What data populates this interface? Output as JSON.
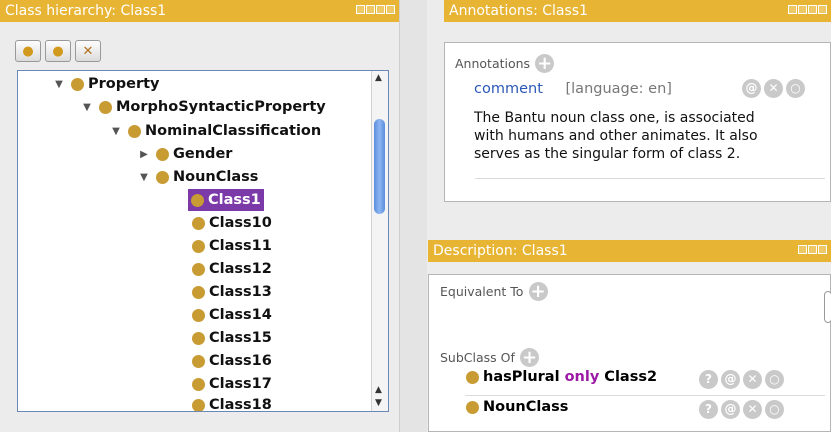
{
  "hierarchy": {
    "title": "Class hierarchy: Class1",
    "tree": [
      {
        "label": "Property",
        "toggle": "▼"
      },
      {
        "label": "MorphoSyntacticProperty",
        "toggle": "▼"
      },
      {
        "label": "NominalClassification",
        "toggle": "▼"
      },
      {
        "label": "Gender",
        "toggle": "▶"
      },
      {
        "label": "NounClass",
        "toggle": "▼"
      },
      {
        "label": "Class1",
        "toggle": ""
      },
      {
        "label": "Class10",
        "toggle": ""
      },
      {
        "label": "Class11",
        "toggle": ""
      },
      {
        "label": "Class12",
        "toggle": ""
      },
      {
        "label": "Class13",
        "toggle": ""
      },
      {
        "label": "Class14",
        "toggle": ""
      },
      {
        "label": "Class15",
        "toggle": ""
      },
      {
        "label": "Class16",
        "toggle": ""
      },
      {
        "label": "Class17",
        "toggle": ""
      },
      {
        "label": "Class18",
        "toggle": ""
      }
    ]
  },
  "annotations": {
    "title": "Annotations: Class1",
    "section_label": "Annotations",
    "property": "comment",
    "language": "[language: en]",
    "text_line1": "The Bantu noun class one, is associated",
    "text_line2": "with humans and other animates. It also",
    "text_line3": "serves as the singular form of class 2."
  },
  "description": {
    "title": "Description: Class1",
    "equivalent_label": "Equivalent To",
    "subclass_label": "SubClass Of",
    "sub1_prop": "hasPlural",
    "sub1_kw": "only",
    "sub1_class": "Class2",
    "sub2": "NounClass"
  },
  "colors": {
    "title_bg": "#e8b433",
    "selection": "#7c3aa8",
    "keyword": "#9c1aa6",
    "link": "#2b58b8"
  }
}
